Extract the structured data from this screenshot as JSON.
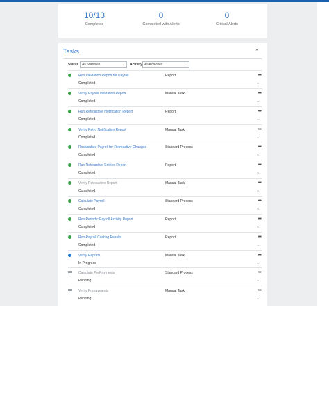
{
  "summary": {
    "completed_value": "10/13",
    "completed_label": "Completed",
    "completed_alerts_value": "0",
    "completed_alerts_label": "Completed with Alerts",
    "critical_value": "0",
    "critical_label": "Critical Alerts"
  },
  "tasks_panel": {
    "title": "Tasks",
    "status_label": "Status",
    "status_value": "All Statuses",
    "activity_label": "Activity",
    "activity_value": "All Activities"
  },
  "rows": [
    {
      "name": "Run Validation Report for Payroll",
      "status": "Completed",
      "type": "Report",
      "state": "completed"
    },
    {
      "name": "Verify Payroll Validation Report",
      "status": "Completed",
      "type": "Manual Task",
      "state": "completed"
    },
    {
      "name": "Run Retroactive Notification Report",
      "status": "Completed",
      "type": "Report",
      "state": "completed"
    },
    {
      "name": "Verify Retro Notification Report",
      "status": "Completed",
      "type": "Manual Task",
      "state": "completed"
    },
    {
      "name": "Recalculate Payroll for Retroactive Changes",
      "status": "Completed",
      "type": "Standard Process",
      "state": "completed"
    },
    {
      "name": "Run Retroactive Entries Report",
      "status": "Completed",
      "type": "Report",
      "state": "completed"
    },
    {
      "name": "Verify Retroactive Report",
      "status": "Completed",
      "type": "Manual Task",
      "state": "completed",
      "grey": true
    },
    {
      "name": "Calculate Payroll",
      "status": "Completed",
      "type": "Standard Process",
      "state": "completed"
    },
    {
      "name": "Run Periodic Payroll Activity Report",
      "status": "Completed",
      "type": "Report",
      "state": "completed"
    },
    {
      "name": "Run Payroll Costing Results",
      "status": "Completed",
      "type": "Report",
      "state": "completed"
    },
    {
      "name": "Verify Reports",
      "status": "In Progress",
      "type": "Manual Task",
      "state": "progress"
    },
    {
      "name": "Calculate PrePayments",
      "status": "Pending",
      "type": "Standard Process",
      "state": "pending",
      "grey": true
    },
    {
      "name": "Verify Prepayments",
      "status": "Pending",
      "type": "Manual Task",
      "state": "pending",
      "grey": true
    }
  ],
  "icons": {
    "more": "more-actions-icon",
    "expand": "chevron-down-icon",
    "collapse": "chevron-up-icon"
  },
  "colors": {
    "accent": "#3a7bc8",
    "completed": "#3aa14a",
    "in_progress": "#2b7bd3",
    "topbar": "#1f5fa8"
  }
}
